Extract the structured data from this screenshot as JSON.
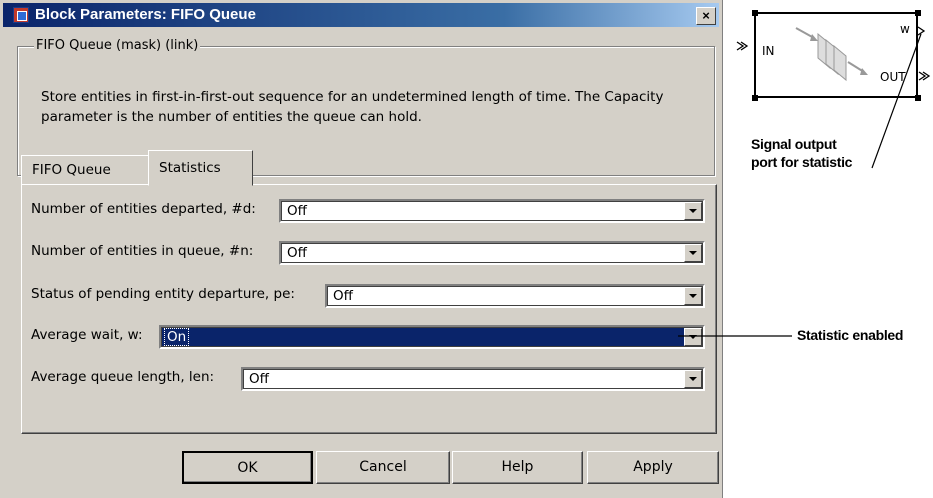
{
  "window": {
    "title": "Block Parameters: FIFO Queue",
    "close_label": "×"
  },
  "group": {
    "legend": "FIFO Queue (mask) (link)",
    "description": "Store entities in first-in-first-out sequence for an undetermined length of time. The Capacity parameter is the number of entities the queue can hold."
  },
  "tabs": [
    {
      "label": "FIFO Queue",
      "active": false
    },
    {
      "label": "Statistics",
      "active": true
    }
  ],
  "parameters": [
    {
      "label": "Number of entities departed, #d:",
      "value": "Off"
    },
    {
      "label": "Number of entities in queue, #n:",
      "value": "Off"
    },
    {
      "label": "Status of pending entity departure, pe:",
      "value": "Off"
    },
    {
      "label": "Average wait, w:",
      "value": "On",
      "selected": true
    },
    {
      "label": "Average queue length, len:",
      "value": "Off"
    }
  ],
  "buttons": {
    "ok": "OK",
    "cancel": "Cancel",
    "help": "Help",
    "apply": "Apply"
  },
  "block": {
    "name": "FIFO Queue",
    "in_port": "IN",
    "out_port": "OUT",
    "w_port": "w"
  },
  "annotations": {
    "signal_output_line1": "Signal output",
    "signal_output_line2": "port for statistic",
    "statistic_enabled": "Statistic enabled"
  },
  "colors": {
    "selection": "#0a246a",
    "dialog_face": "#d4d0c8",
    "titlebar_start": "#0a246a",
    "titlebar_end": "#a6caf0"
  }
}
